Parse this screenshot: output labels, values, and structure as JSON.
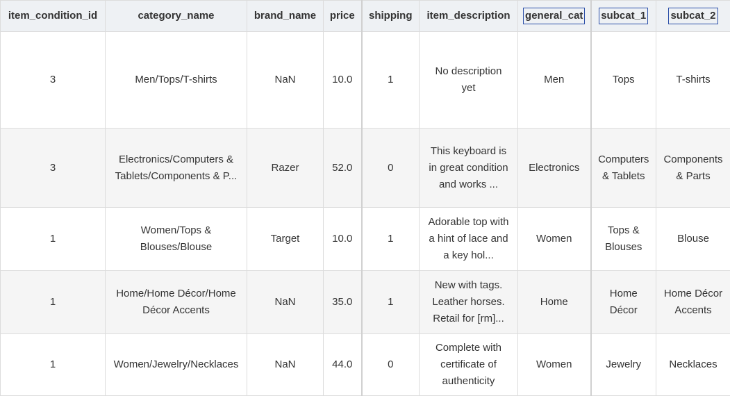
{
  "columns": [
    "item_condition_id",
    "category_name",
    "brand_name",
    "price",
    "shipping",
    "item_description",
    "general_cat",
    "subcat_1",
    "subcat_2"
  ],
  "rows": [
    {
      "item_condition_id": "3",
      "category_name": "Men/Tops/T-shirts",
      "brand_name": "NaN",
      "price": "10.0",
      "shipping": "1",
      "item_description": "No description yet",
      "general_cat": "Men",
      "subcat_1": "Tops",
      "subcat_2": "T-shirts"
    },
    {
      "item_condition_id": "3",
      "category_name": "Electronics/Computers & Tablets/Components & P...",
      "brand_name": "Razer",
      "price": "52.0",
      "shipping": "0",
      "item_description": "This keyboard is in great condition and works ...",
      "general_cat": "Electronics",
      "subcat_1": "Computers & Tablets",
      "subcat_2": "Components & Parts"
    },
    {
      "item_condition_id": "1",
      "category_name": "Women/Tops & Blouses/Blouse",
      "brand_name": "Target",
      "price": "10.0",
      "shipping": "1",
      "item_description": "Adorable top with a hint of lace and a key hol...",
      "general_cat": "Women",
      "subcat_1": "Tops & Blouses",
      "subcat_2": "Blouse"
    },
    {
      "item_condition_id": "1",
      "category_name": "Home/Home Décor/Home Décor Accents",
      "brand_name": "NaN",
      "price": "35.0",
      "shipping": "1",
      "item_description": "New with tags. Leather horses. Retail for [rm]...",
      "general_cat": "Home",
      "subcat_1": "Home Décor",
      "subcat_2": "Home Décor Accents"
    },
    {
      "item_condition_id": "1",
      "category_name": "Women/Jewelry/Necklaces",
      "brand_name": "NaN",
      "price": "44.0",
      "shipping": "0",
      "item_description": "Complete with certificate of authenticity",
      "general_cat": "Women",
      "subcat_1": "Jewelry",
      "subcat_2": "Necklaces"
    }
  ]
}
